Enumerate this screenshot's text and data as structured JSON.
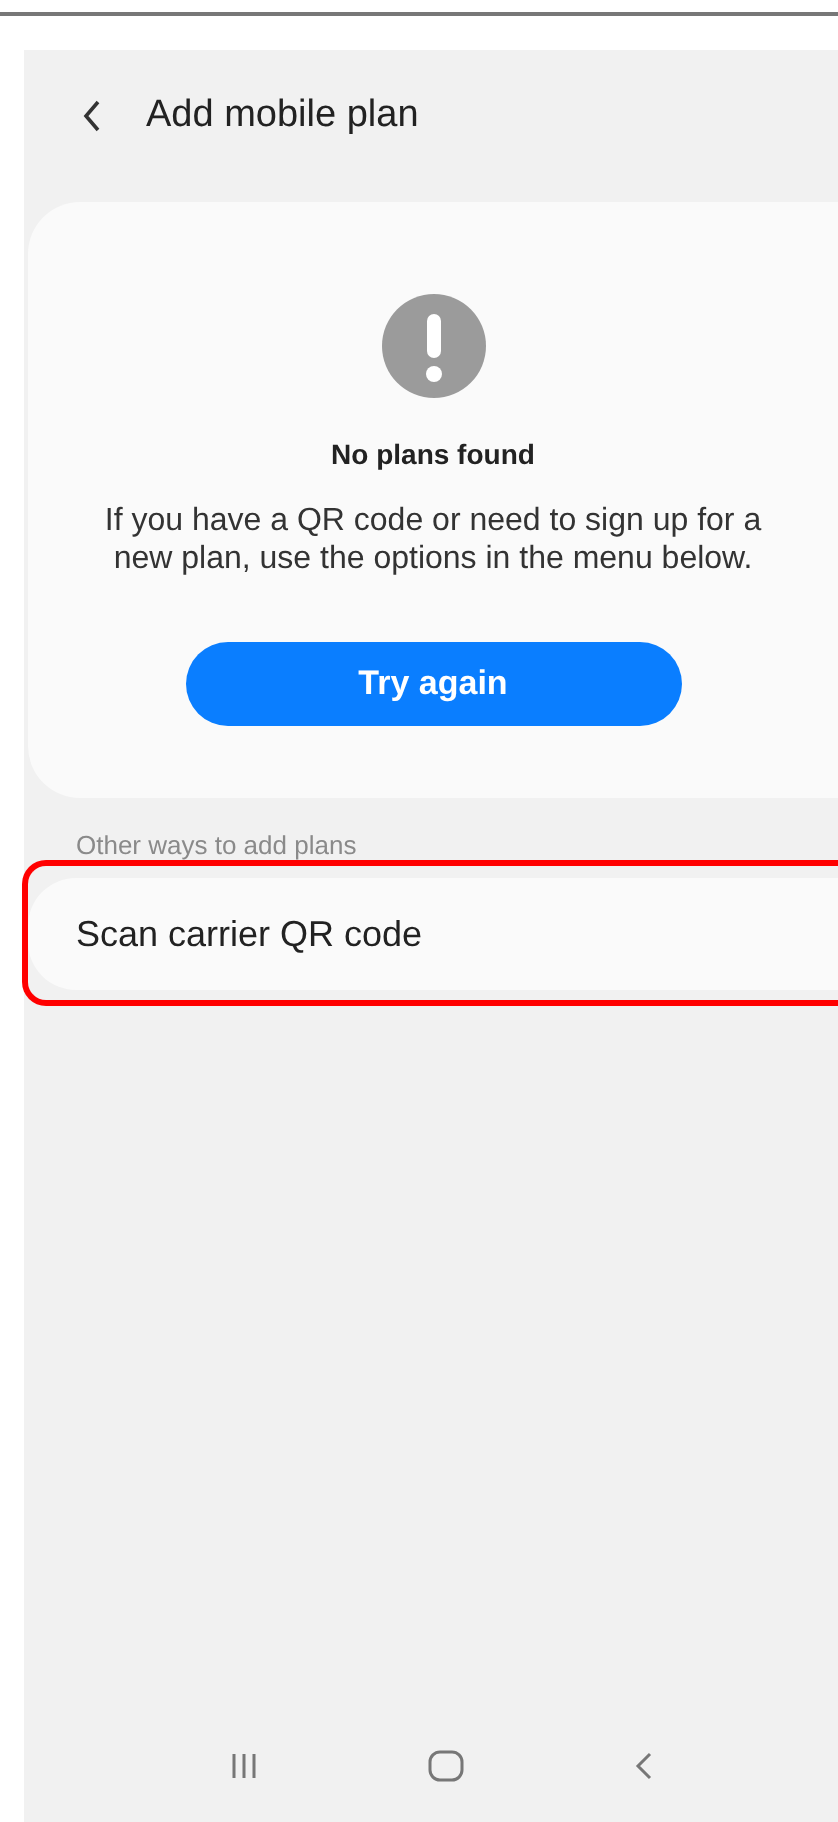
{
  "header": {
    "title": "Add mobile plan"
  },
  "card": {
    "title": "No plans found",
    "message": "If you have a QR code or need to sign up for a new plan, use the options in the menu below.",
    "button": "Try again"
  },
  "section_label": "Other ways to add plans",
  "menu_items": [
    {
      "label": "Scan carrier QR code",
      "highlighted": true
    }
  ]
}
